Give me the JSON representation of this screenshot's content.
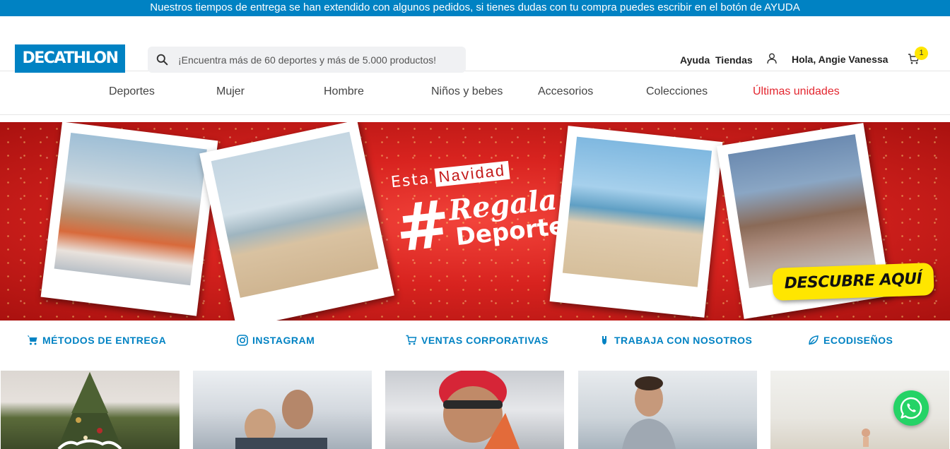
{
  "promo": {
    "text": "Nuestros tiempos de entrega se han extendido con algunos pedidos, si tienes dudas con tu compra puedes escribir en el botón de AYUDA"
  },
  "header": {
    "logo": "DECATHLON",
    "search_placeholder": "¡Encuentra más de 60 deportes y más de 5.000 productos!",
    "help": "Ayuda",
    "stores": "Tiendas",
    "greeting": "Hola, Angie Vanessa",
    "cart_count": "1"
  },
  "nav": {
    "items": [
      "Deportes",
      "Mujer",
      "Hombre",
      "Niños y bebes",
      "Accesorios",
      "Colecciones",
      "Últimas unidades"
    ]
  },
  "banner": {
    "esta": "Esta",
    "navidad": "Navidad",
    "hash": "#",
    "regala": "Regala",
    "deporte": "Deporte",
    "cta": "DESCUBRE AQUÍ"
  },
  "links": {
    "items": [
      "MÉTODOS DE ENTREGA",
      "INSTAGRAM",
      "VENTAS CORPORATIVAS",
      "TRABAJA CON NOSOTROS",
      "ECODISEÑOS"
    ]
  },
  "colors": {
    "brand": "#0082c3",
    "sale_red": "#e3262f",
    "cta_yellow": "#ffe600",
    "whatsapp": "#25d366"
  }
}
